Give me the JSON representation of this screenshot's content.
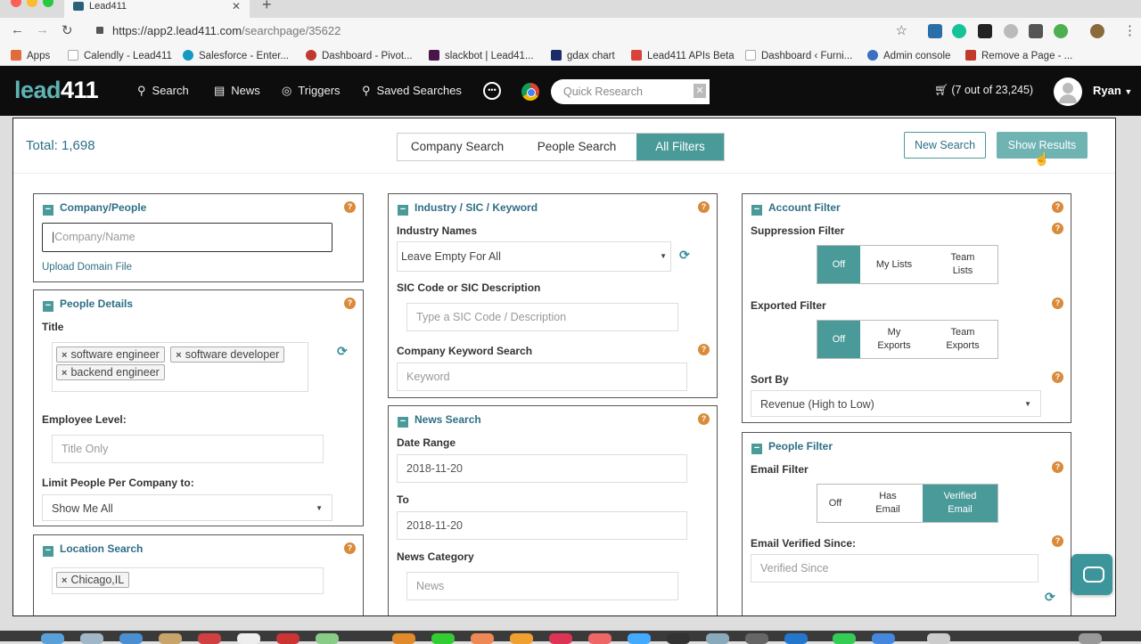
{
  "browser": {
    "tab_title": "Lead411",
    "url_host": "https://app2.lead411.com",
    "url_path": "/searchpage/35622",
    "bookmarks": [
      "Apps",
      "Calendly - Lead411",
      "Salesforce - Enter...",
      "Dashboard - Pivot...",
      "slackbot | Lead41...",
      "gdax chart",
      "Lead411 APIs Beta",
      "Dashboard ‹ Furni...",
      "Admin console",
      "Remove a Page - ..."
    ]
  },
  "nav": {
    "logo_a": "lead",
    "logo_b": "411",
    "items": [
      "Search",
      "News",
      "Triggers",
      "Saved Searches"
    ],
    "more": "•••",
    "quick_research_placeholder": "Quick Research",
    "cart": "(7 out of 23,245)",
    "user": "Ryan"
  },
  "topbar": {
    "total": "Total: 1,698",
    "tabs": [
      "Company Search",
      "People Search",
      "All Filters"
    ],
    "new_search": "New Search",
    "show_results": "Show Results"
  },
  "company_people": {
    "title": "Company/People",
    "placeholder": "Company/Name",
    "upload": "Upload Domain File"
  },
  "people_details": {
    "title": "People Details",
    "title_label": "Title",
    "tags": [
      "software engineer",
      "software developer",
      "backend engineer"
    ],
    "employee_level_label": "Employee Level:",
    "employee_level_placeholder": "Title Only",
    "limit_label": "Limit People Per Company to:",
    "limit_value": "Show Me All"
  },
  "location": {
    "title": "Location Search",
    "tags": [
      "Chicago,IL"
    ]
  },
  "industry": {
    "title": "Industry / SIC / Keyword",
    "names_label": "Industry Names",
    "names_value": "Leave Empty For All",
    "sic_label": "SIC Code or SIC Description",
    "sic_placeholder": "Type a SIC Code / Description",
    "keyword_label": "Company Keyword Search",
    "keyword_placeholder": "Keyword"
  },
  "news": {
    "title": "News Search",
    "date_range_label": "Date Range",
    "from": "2018-11-20",
    "to_label": "To",
    "to": "2018-11-20",
    "category_label": "News Category",
    "category_placeholder": "News"
  },
  "account": {
    "title": "Account Filter",
    "suppression_label": "Suppression Filter",
    "suppression_options": [
      "Off",
      "My Lists",
      "Team Lists"
    ],
    "exported_label": "Exported Filter",
    "exported_options": [
      "Off",
      "My Exports",
      "Team Exports"
    ],
    "sort_label": "Sort By",
    "sort_value": "Revenue (High to Low)"
  },
  "people_filter": {
    "title": "People Filter",
    "email_label": "Email Filter",
    "email_options": [
      "Off",
      "Has Email",
      "Verified Email"
    ],
    "verified_label": "Email Verified Since:",
    "verified_placeholder": "Verified Since"
  }
}
